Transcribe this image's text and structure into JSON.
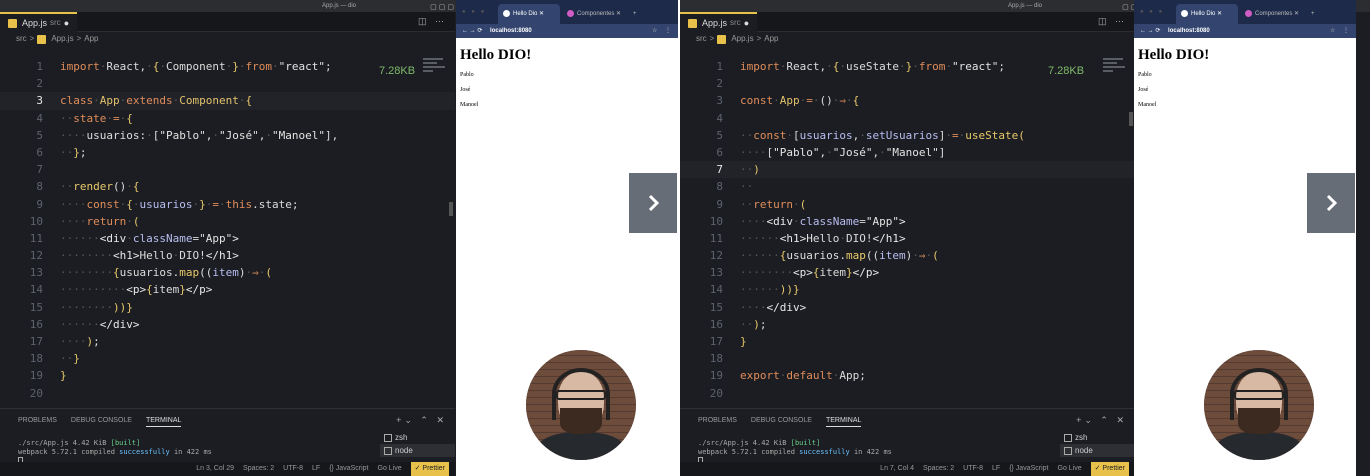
{
  "left": {
    "window_title": "App.js — dio",
    "tab_label": "App.js",
    "tab_dir": "src",
    "breadcrumb": [
      "src",
      ">",
      "App.js",
      ">",
      "App"
    ],
    "size_badge": "7.28KB",
    "code_lines": [
      {
        "n": "1",
        "html": "<span class='kw'>import</span><span class='dot'>·</span><span class='pl'>React,</span><span class='dot'>·</span><span class='pn'>{</span><span class='dot'>·</span><span class='pl'>Component</span><span class='dot'>·</span><span class='pn'>}</span><span class='dot'>·</span><span class='kw'>from</span><span class='dot'>·</span><span class='st'>\"react\"</span><span class='pl'>;</span>"
      },
      {
        "n": "2",
        "html": ""
      },
      {
        "n": "3",
        "html": "<span class='kw'>class</span><span class='dot'>·</span><span class='cl'>App</span><span class='dot'>·</span><span class='kw'>extends</span><span class='dot'>·</span><span class='cl'>Component</span><span class='dot'>·</span><span class='pn'>{</span>",
        "cur": true
      },
      {
        "n": "4",
        "html": "<span class='dot'>··</span><span class='kw'>state</span><span class='dot'>·</span><span class='kw'>=</span><span class='dot'>·</span><span class='pn'>{</span>"
      },
      {
        "n": "5",
        "html": "<span class='dot'>····</span><span class='pl'>usuarios:</span><span class='dot'>·</span><span class='pl'>[</span><span class='st'>\"Pablo\"</span><span class='pl'>,</span><span class='dot'>·</span><span class='st'>\"José\"</span><span class='pl'>,</span><span class='dot'>·</span><span class='st'>\"Manoel\"</span><span class='pl'>],</span>"
      },
      {
        "n": "6",
        "html": "<span class='dot'>··</span><span class='pn'>}</span><span class='pl'>;</span>"
      },
      {
        "n": "7",
        "html": ""
      },
      {
        "n": "8",
        "html": "<span class='dot'>··</span><span class='fn'>render</span><span class='pl'>()</span><span class='dot'>·</span><span class='pn'>{</span>"
      },
      {
        "n": "9",
        "html": "<span class='dot'>····</span><span class='kw'>const</span><span class='dot'>·</span><span class='pn'>{</span><span class='dot'>·</span><span class='id'>usuarios</span><span class='dot'>·</span><span class='pn'>}</span><span class='dot'>·</span><span class='kw'>=</span><span class='dot'>·</span><span class='kw'>this</span><span class='pl'>.state;</span>"
      },
      {
        "n": "10",
        "html": "<span class='dot'>····</span><span class='kw'>return</span><span class='dot'>·</span><span class='pn'>(</span>"
      },
      {
        "n": "11",
        "html": "<span class='dot'>······</span><span class='tg'>&lt;div</span><span class='dot'>·</span><span class='at'>className</span><span class='pl'>=</span><span class='st'>\"App\"</span><span class='tg'>&gt;</span>"
      },
      {
        "n": "12",
        "html": "<span class='dot'>········</span><span class='tg'>&lt;h1&gt;</span><span class='pl'>Hello</span><span class='dot'>·</span><span class='pl'>DIO!</span><span class='tg'>&lt;/h1&gt;</span>"
      },
      {
        "n": "13",
        "html": "<span class='dot'>········</span><span class='pn'>{</span><span class='pl'>usuarios.</span><span class='fn'>map</span><span class='pl'>((</span><span class='id'>item</span><span class='pl'>)</span><span class='dot'>·</span><span class='kw'>⇒</span><span class='dot'>·</span><span class='pn'>(</span>"
      },
      {
        "n": "14",
        "html": "<span class='dot'>··········</span><span class='tg'>&lt;p&gt;</span><span class='pn'>{</span><span class='pl'>item</span><span class='pn'>}</span><span class='tg'>&lt;/p&gt;</span>"
      },
      {
        "n": "15",
        "html": "<span class='dot'>········</span><span class='pn'>))}</span>"
      },
      {
        "n": "16",
        "html": "<span class='dot'>······</span><span class='tg'>&lt;/div&gt;</span>"
      },
      {
        "n": "17",
        "html": "<span class='dot'>····</span><span class='pn'>)</span><span class='pl'>;</span>"
      },
      {
        "n": "18",
        "html": "<span class='dot'>··</span><span class='pn'>}</span>"
      },
      {
        "n": "19",
        "html": "<span class='pn'>}</span>"
      },
      {
        "n": "20",
        "html": ""
      }
    ],
    "panel_tabs": [
      "PROBLEMS",
      "DEBUG CONSOLE",
      "TERMINAL"
    ],
    "terminal": {
      "l1a": "./src/App.js 4.42 KiB",
      "l1b": "[built]",
      "l2a": "webpack 5.72.1 compiled",
      "l2b": "successfully",
      "l2c": "in 422 ms"
    },
    "shells": [
      "zsh",
      "node"
    ],
    "status": [
      "Ln 3, Col 29",
      "Spaces: 2",
      "UTF-8",
      "LF",
      "{} JavaScript",
      "Go Live",
      "✓ Prettier"
    ],
    "browser": {
      "tab1": "Hello Dio",
      "tab2": "Componentes",
      "url": "localhost:8080",
      "h1": "Hello DIO!",
      "items": [
        "Pablo",
        "José",
        "Manoel"
      ]
    }
  },
  "right": {
    "window_title": "App.js — dio",
    "tab_label": "App.js",
    "tab_dir": "src",
    "breadcrumb": [
      "src",
      ">",
      "App.js",
      ">",
      "App"
    ],
    "size_badge": "7.28KB",
    "code_lines": [
      {
        "n": "1",
        "html": "<span class='kw'>import</span><span class='dot'>·</span><span class='pl'>React,</span><span class='dot'>·</span><span class='pn'>{</span><span class='dot'>·</span><span class='pl'>useState</span><span class='dot'>·</span><span class='pn'>}</span><span class='dot'>·</span><span class='kw'>from</span><span class='dot'>·</span><span class='st'>\"react\"</span><span class='pl'>;</span>"
      },
      {
        "n": "2",
        "html": ""
      },
      {
        "n": "3",
        "html": "<span class='kw'>const</span><span class='dot'>·</span><span class='cl'>App</span><span class='dot'>·</span><span class='kw'>=</span><span class='dot'>·</span><span class='pl'>()</span><span class='dot'>·</span><span class='kw'>⇒</span><span class='dot'>·</span><span class='pn'>{</span>"
      },
      {
        "n": "4",
        "html": ""
      },
      {
        "n": "5",
        "html": "<span class='dot'>··</span><span class='kw'>const</span><span class='dot'>·</span><span class='pl'>[</span><span class='id'>usuarios</span><span class='pl'>,</span><span class='dot'>·</span><span class='id'>setUsuarios</span><span class='pl'>]</span><span class='dot'>·</span><span class='kw'>=</span><span class='dot'>·</span><span class='fn'>useState</span><span class='pn'>(</span>"
      },
      {
        "n": "6",
        "html": "<span class='dot'>····</span><span class='pl'>[</span><span class='st'>\"Pablo\"</span><span class='pl'>,</span><span class='dot'>·</span><span class='st'>\"José\"</span><span class='pl'>,</span><span class='dot'>·</span><span class='st'>\"Manoel\"</span><span class='pl'>]</span>"
      },
      {
        "n": "7",
        "html": "<span class='dot'>··</span><span class='pn'>)</span>",
        "cur": true
      },
      {
        "n": "8",
        "html": "<span class='dot'>··</span>"
      },
      {
        "n": "9",
        "html": "<span class='dot'>··</span><span class='kw'>return</span><span class='dot'>·</span><span class='pn'>(</span>"
      },
      {
        "n": "10",
        "html": "<span class='dot'>····</span><span class='tg'>&lt;div</span><span class='dot'>·</span><span class='at'>className</span><span class='pl'>=</span><span class='st'>\"App\"</span><span class='tg'>&gt;</span>"
      },
      {
        "n": "11",
        "html": "<span class='dot'>······</span><span class='tg'>&lt;h1&gt;</span><span class='pl'>Hello</span><span class='dot'>·</span><span class='pl'>DIO!</span><span class='tg'>&lt;/h1&gt;</span>"
      },
      {
        "n": "12",
        "html": "<span class='dot'>······</span><span class='pn'>{</span><span class='pl'>usuarios.</span><span class='fn'>map</span><span class='pl'>((</span><span class='id'>item</span><span class='pl'>)</span><span class='dot'>·</span><span class='kw'>⇒</span><span class='dot'>·</span><span class='pn'>(</span>"
      },
      {
        "n": "13",
        "html": "<span class='dot'>········</span><span class='tg'>&lt;p&gt;</span><span class='pn'>{</span><span class='pl'>item</span><span class='pn'>}</span><span class='tg'>&lt;/p&gt;</span>"
      },
      {
        "n": "14",
        "html": "<span class='dot'>······</span><span class='pn'>))}</span>"
      },
      {
        "n": "15",
        "html": "<span class='dot'>····</span><span class='tg'>&lt;/div&gt;</span>"
      },
      {
        "n": "16",
        "html": "<span class='dot'>··</span><span class='pn'>)</span><span class='pl'>;</span>"
      },
      {
        "n": "17",
        "html": "<span class='pn'>}</span>"
      },
      {
        "n": "18",
        "html": ""
      },
      {
        "n": "19",
        "html": "<span class='kw'>export</span><span class='dot'>·</span><span class='kw'>default</span><span class='dot'>·</span><span class='pl'>App;</span>"
      },
      {
        "n": "20",
        "html": ""
      }
    ],
    "panel_tabs": [
      "PROBLEMS",
      "DEBUG CONSOLE",
      "TERMINAL"
    ],
    "terminal": {
      "l1a": "./src/App.js 4.42 KiB",
      "l1b": "[built]",
      "l2a": "webpack 5.72.1 compiled",
      "l2b": "successfully",
      "l2c": "in 422 ms"
    },
    "shells": [
      "zsh",
      "node"
    ],
    "status": [
      "Ln 7, Col 4",
      "Spaces: 2",
      "UTF-8",
      "LF",
      "{} JavaScript",
      "Go Live",
      "✓ Prettier"
    ],
    "browser": {
      "tab1": "Hello Dio",
      "tab2": "Componentes",
      "url": "localhost:8080",
      "h1": "Hello DIO!",
      "items": [
        "Pablo",
        "José",
        "Manoel"
      ]
    }
  },
  "icons": [
    "chevron-right-icon",
    "js-file-icon",
    "split-editor-icon",
    "terminal-icon",
    "webcam-avatar"
  ]
}
